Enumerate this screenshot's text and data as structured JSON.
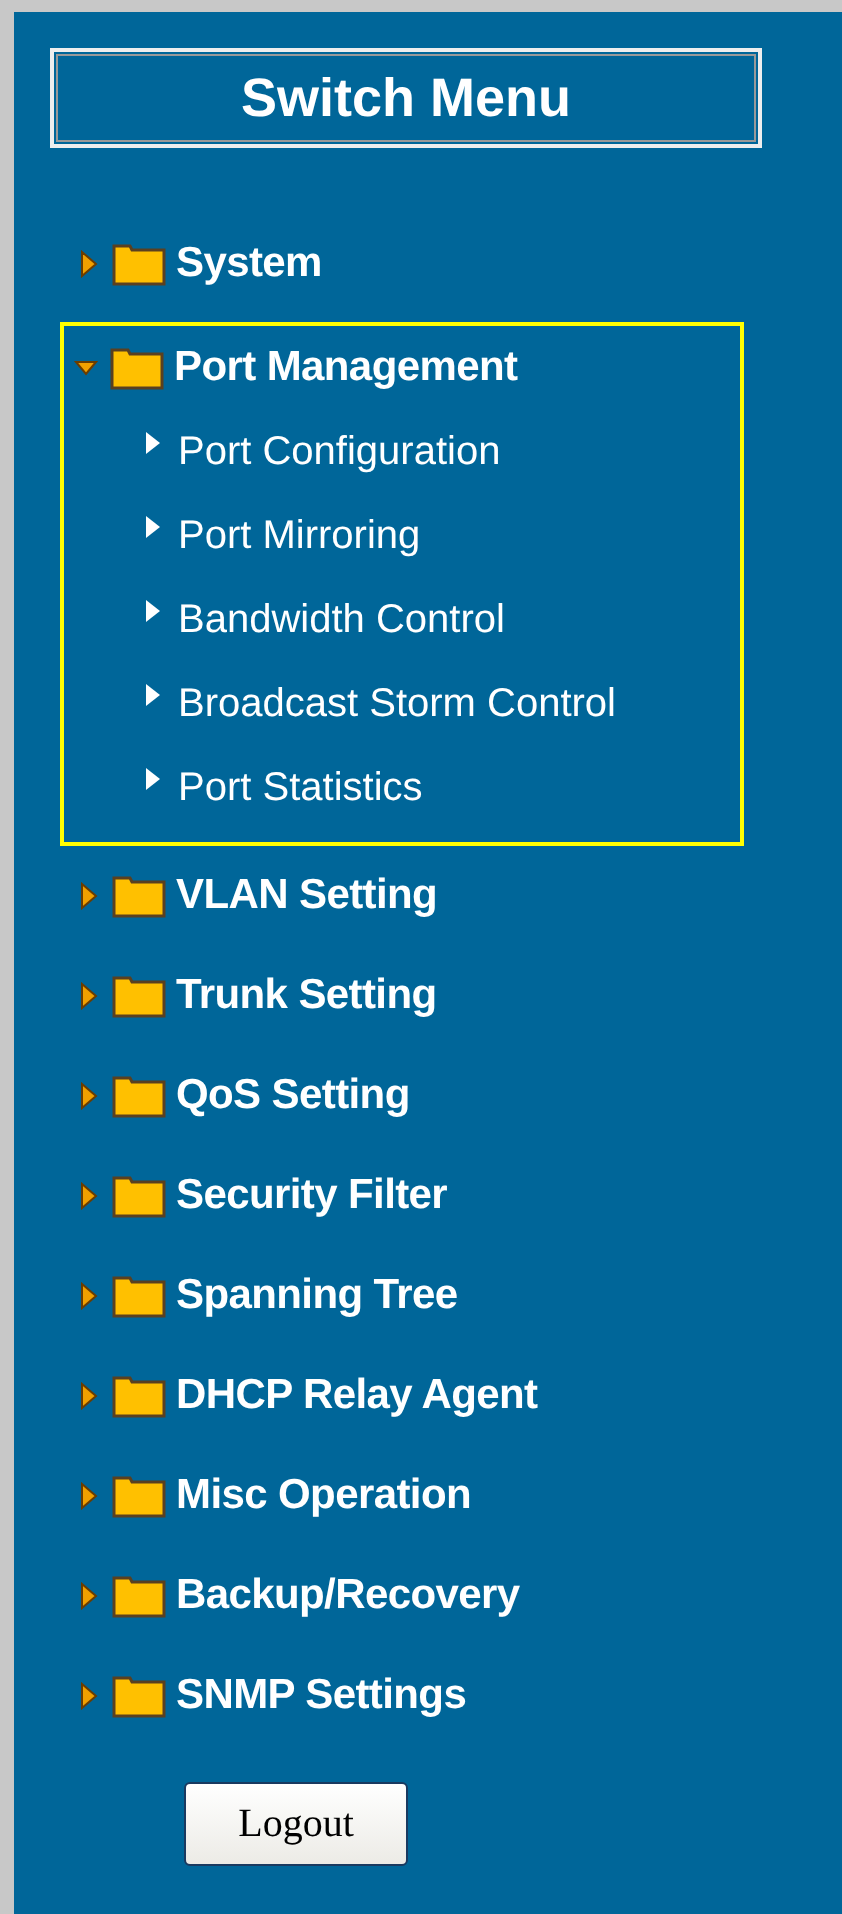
{
  "title": "Switch Menu",
  "menu": [
    {
      "label": "System",
      "expanded": false
    },
    {
      "label": "Port Management",
      "expanded": true,
      "children": [
        {
          "label": "Port Configuration"
        },
        {
          "label": "Port Mirroring"
        },
        {
          "label": "Bandwidth Control"
        },
        {
          "label": "Broadcast Storm Control"
        },
        {
          "label": "Port Statistics"
        }
      ]
    },
    {
      "label": "VLAN Setting",
      "expanded": false
    },
    {
      "label": "Trunk Setting",
      "expanded": false
    },
    {
      "label": "QoS Setting",
      "expanded": false
    },
    {
      "label": "Security Filter",
      "expanded": false
    },
    {
      "label": "Spanning Tree",
      "expanded": false
    },
    {
      "label": "DHCP Relay Agent",
      "expanded": false
    },
    {
      "label": "Misc Operation",
      "expanded": false
    },
    {
      "label": "Backup/Recovery",
      "expanded": false
    },
    {
      "label": "SNMP Settings",
      "expanded": false
    }
  ],
  "logout_button": "Logout"
}
